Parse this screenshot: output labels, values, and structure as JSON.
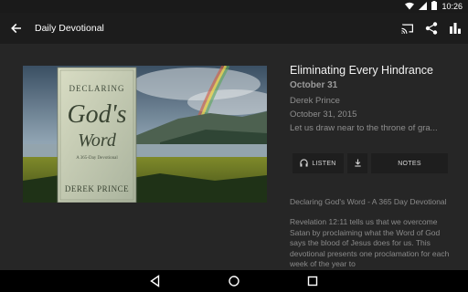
{
  "status_bar": {
    "time": "10:26",
    "icons": [
      "wifi-icon",
      "signal-icon",
      "battery-icon"
    ]
  },
  "app_bar": {
    "title": "Daily Devotional",
    "icons": [
      "back-arrow-icon",
      "cast-icon",
      "share-icon",
      "bar-chart-icon"
    ]
  },
  "cover": {
    "book_title_1": "DECLARING",
    "book_title_2": "God's",
    "book_title_3": "Word",
    "book_subtitle": "A 365-Day Devotional",
    "author": "DEREK PRINCE"
  },
  "devotional": {
    "heading": "Eliminating Every Hindrance",
    "date": "October 31",
    "author": "Derek Prince",
    "full_date": "October 31, 2015",
    "preview": "Let us draw near to the throne of gra..."
  },
  "buttons": {
    "listen": "LISTEN",
    "notes": "NOTES"
  },
  "book_info": {
    "title": "Declaring God's Word - A 365 Day Devotional",
    "description": "Revelation 12:11 tells us that we overcome Satan by proclaiming what the Word of God says the blood of Jesus does for us. This devotional presents one proclamation for each week of the year to"
  },
  "colors": {
    "background": "#262626",
    "app_bar": "#1c1c1c",
    "button": "#1e1e1e"
  }
}
